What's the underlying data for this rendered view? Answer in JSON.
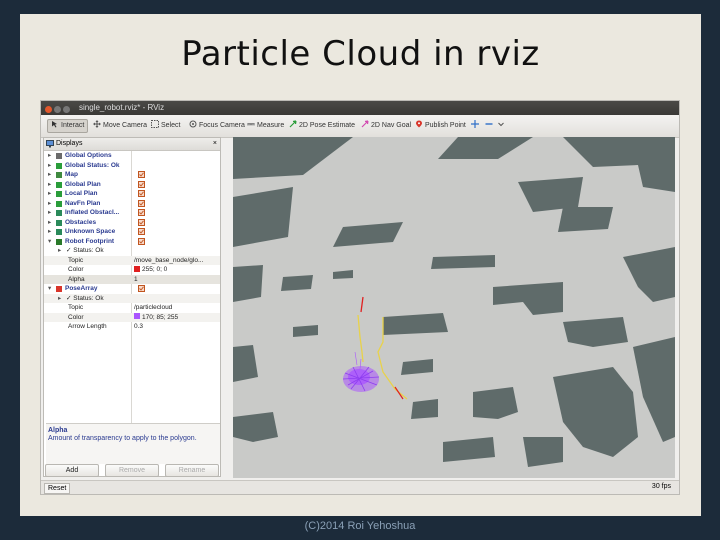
{
  "slide": {
    "title": "Particle Cloud in rviz",
    "footer": "(C)2014 Roi Yehoshua"
  },
  "window": {
    "title": "single_robot.rviz* - RViz"
  },
  "toolbar": {
    "tools": [
      {
        "label": "Interact",
        "icon": "interact-icon",
        "active": true
      },
      {
        "label": "Move Camera",
        "icon": "move-camera-icon"
      },
      {
        "label": "Select",
        "icon": "select-icon"
      },
      {
        "label": "Focus Camera",
        "icon": "focus-camera-icon"
      },
      {
        "label": "Measure",
        "icon": "measure-icon"
      },
      {
        "label": "2D Pose Estimate",
        "icon": "pose-estimate-icon"
      },
      {
        "label": "2D Nav Goal",
        "icon": "nav-goal-icon"
      },
      {
        "label": "Publish Point",
        "icon": "publish-point-icon"
      }
    ],
    "more_icons": [
      "crosshair-icon",
      "minus-icon",
      "chevron-down-icon"
    ]
  },
  "displays": {
    "panel_title": "Displays",
    "close_glyph": "×",
    "rows": [
      {
        "name": "Global Options",
        "icon": "gear-icon",
        "arrow": "▸",
        "checked": false
      },
      {
        "name": "Global Status: Ok",
        "icon": "check-icon",
        "arrow": "▸",
        "checked": false
      },
      {
        "name": "Map",
        "icon": "map-icon",
        "arrow": "▸",
        "checked": true
      },
      {
        "name": "Global Plan",
        "icon": "path-icon",
        "arrow": "▸",
        "checked": true
      },
      {
        "name": "Local Plan",
        "icon": "path-icon",
        "arrow": "▸",
        "checked": true
      },
      {
        "name": "NavFn Plan",
        "icon": "path-icon",
        "arrow": "▸",
        "checked": true
      },
      {
        "name": "Inflated Obstacl...",
        "icon": "grid-cells-icon",
        "arrow": "▸",
        "checked": true
      },
      {
        "name": "Obstacles",
        "icon": "grid-cells-icon",
        "arrow": "▸",
        "checked": true
      },
      {
        "name": "Unknown Space",
        "icon": "grid-cells-icon",
        "arrow": "▸",
        "checked": true
      },
      {
        "name": "Robot Footprint",
        "icon": "polygon-icon",
        "arrow": "▾",
        "checked": true
      },
      {
        "name": "✓ Status: Ok",
        "sub": true,
        "arrow": "▸"
      },
      {
        "name": "Topic",
        "sub": true,
        "value": "/move_base_node/glo..."
      },
      {
        "name": "Color",
        "sub": true,
        "value": "255; 0; 0",
        "swatch": "#e02020"
      },
      {
        "name": "Alpha",
        "sub": true,
        "value": "1",
        "selected": true
      },
      {
        "name": "PoseArray",
        "icon": "pose-array-icon",
        "arrow": "▾",
        "checked": true
      },
      {
        "name": "✓ Status: Ok",
        "sub": true,
        "arrow": "▸"
      },
      {
        "name": "Topic",
        "sub": true,
        "value": "/particlecloud"
      },
      {
        "name": "Color",
        "sub": true,
        "value": "170; 85; 255",
        "swatch": "#aa55ff"
      },
      {
        "name": "Arrow Length",
        "sub": true,
        "value": "0.3"
      }
    ],
    "help_title": "Alpha",
    "help_text": "Amount of transparency to apply to the polygon.",
    "buttons": {
      "add": "Add",
      "remove": "Remove",
      "rename": "Rename"
    }
  },
  "statusbar": {
    "reset_label": "Reset",
    "fps": "30 fps"
  },
  "colors": {
    "map_free": "#c9cac8",
    "map_obstacle": "#5f6b6a",
    "particles": "#aa55ff",
    "global_plan": "#e8d24a",
    "local_plan": "#e02020"
  }
}
